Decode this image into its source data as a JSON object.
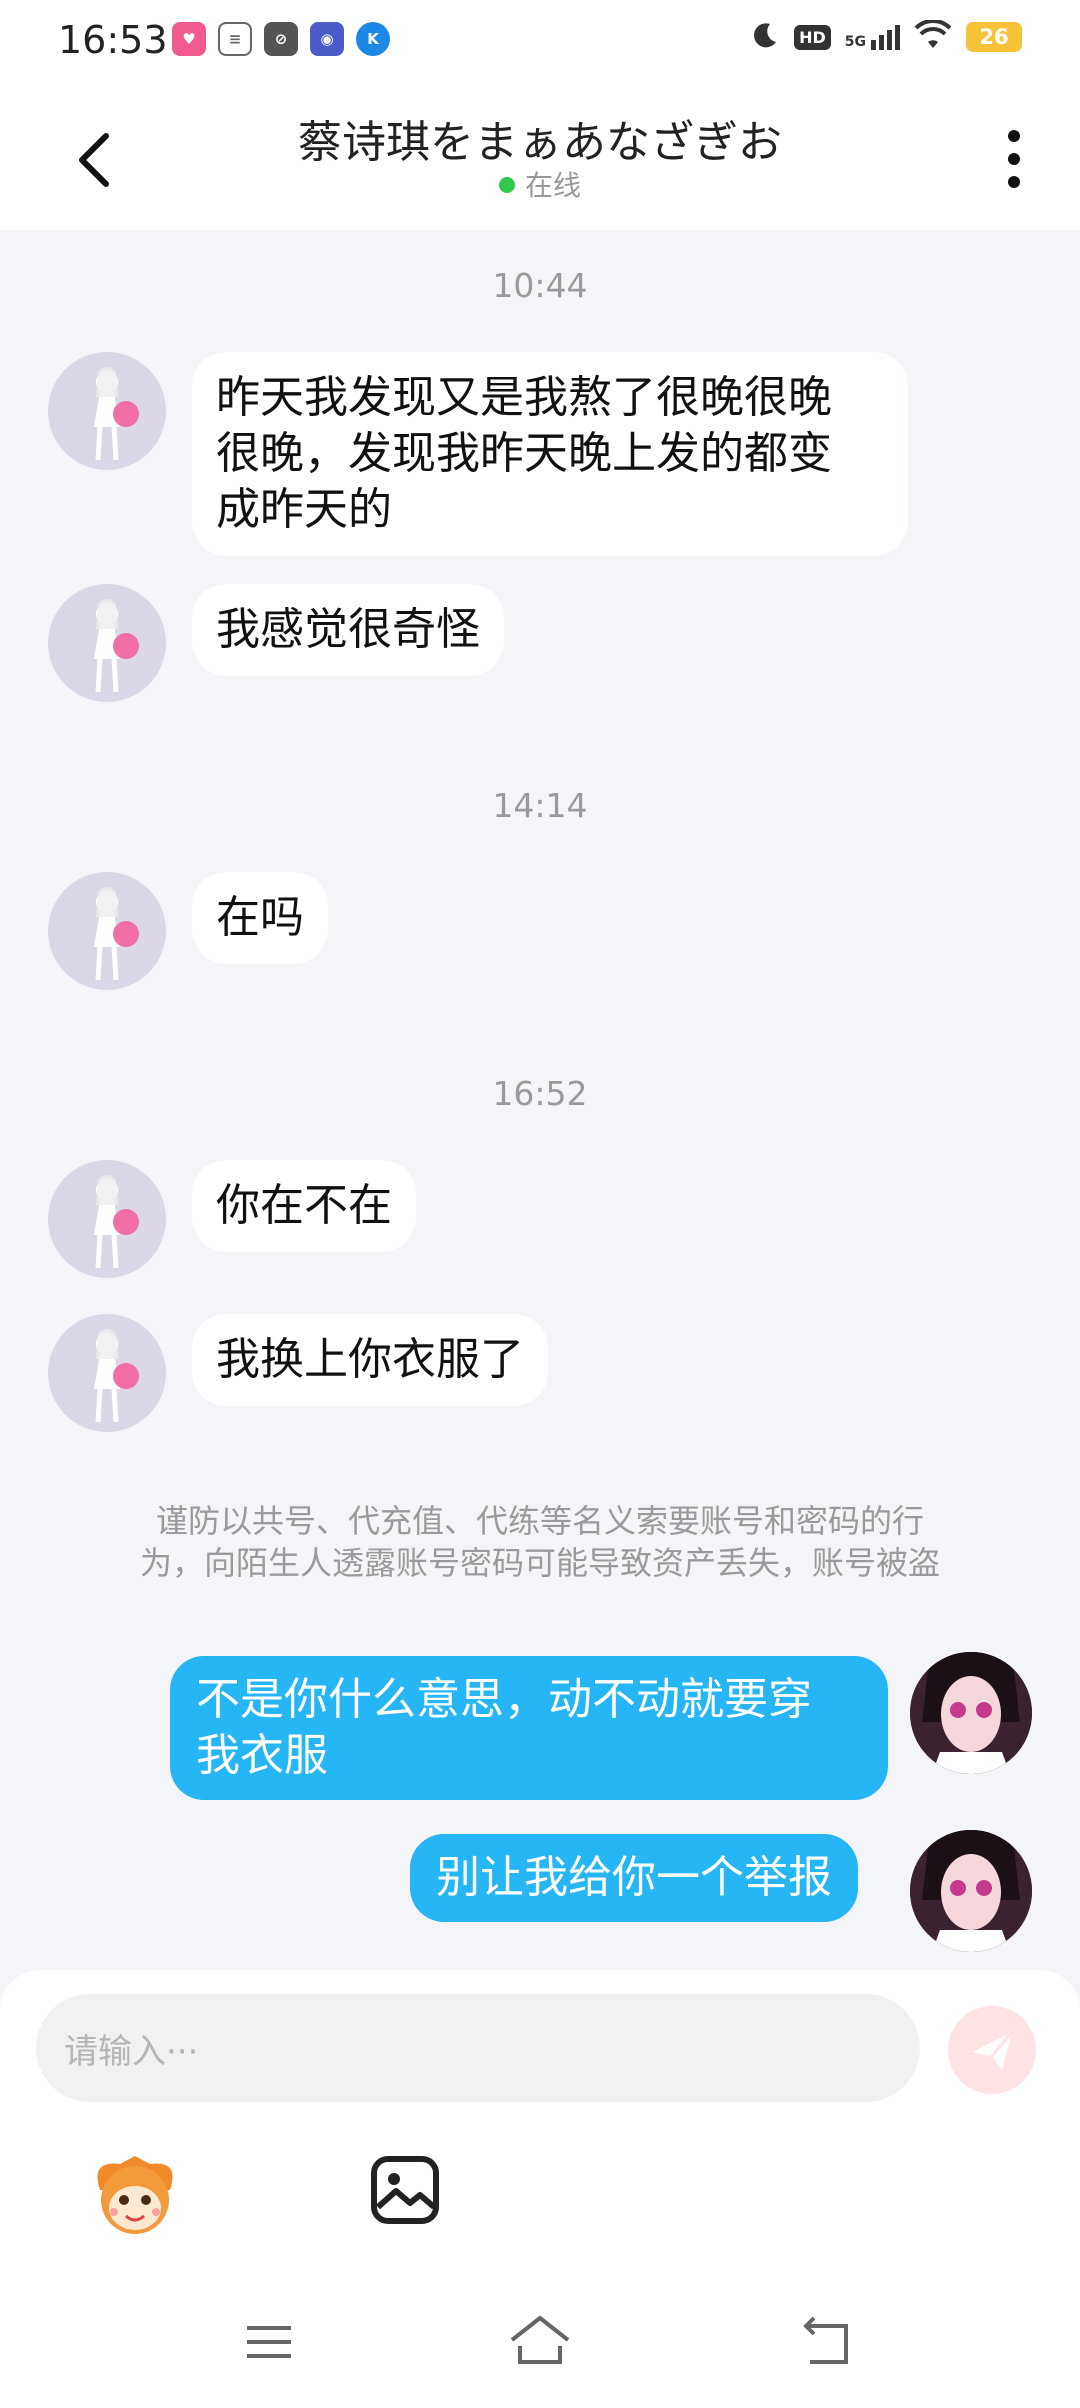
{
  "status_bar": {
    "time": "16:53",
    "hd": "HD",
    "network": "5G",
    "battery": "26"
  },
  "header": {
    "title": "蔡诗琪をまぁあなざぎお",
    "status": "在线"
  },
  "messages": [
    {
      "type": "time",
      "text": "10:44"
    },
    {
      "type": "received",
      "lines": [
        "昨天我发现又是我熬了很晚很晚",
        "很晚，发现我昨天晚上发的都变",
        "成昨天的"
      ]
    },
    {
      "type": "received",
      "text": "我感觉很奇怪"
    },
    {
      "type": "time",
      "text": "14:14"
    },
    {
      "type": "received",
      "text": "在吗"
    },
    {
      "type": "time",
      "text": "16:52"
    },
    {
      "type": "received",
      "text": "你在不在"
    },
    {
      "type": "received",
      "text": "我换上你衣服了"
    },
    {
      "type": "sent",
      "lines": [
        "不是你什么意思，动不动就要穿",
        "我衣服"
      ]
    },
    {
      "type": "sent",
      "text": "别让我给你一个举报"
    }
  ],
  "warning": {
    "line1": "谨防以共号、代充值、代练等名义索要账号和密码的行",
    "line2": "为，向陌生人透露账号密码可能导致资产丢失，账号被盗"
  },
  "input": {
    "placeholder": "请输入···"
  },
  "colors": {
    "accent_blue": "#26b5f5",
    "online_green": "#2fc84a",
    "background": "#f4f5f9"
  },
  "icons": [
    "back-icon",
    "more-icon",
    "send-icon",
    "emoji-icon",
    "image-icon",
    "menu-icon",
    "home-icon",
    "nav-back-icon"
  ]
}
